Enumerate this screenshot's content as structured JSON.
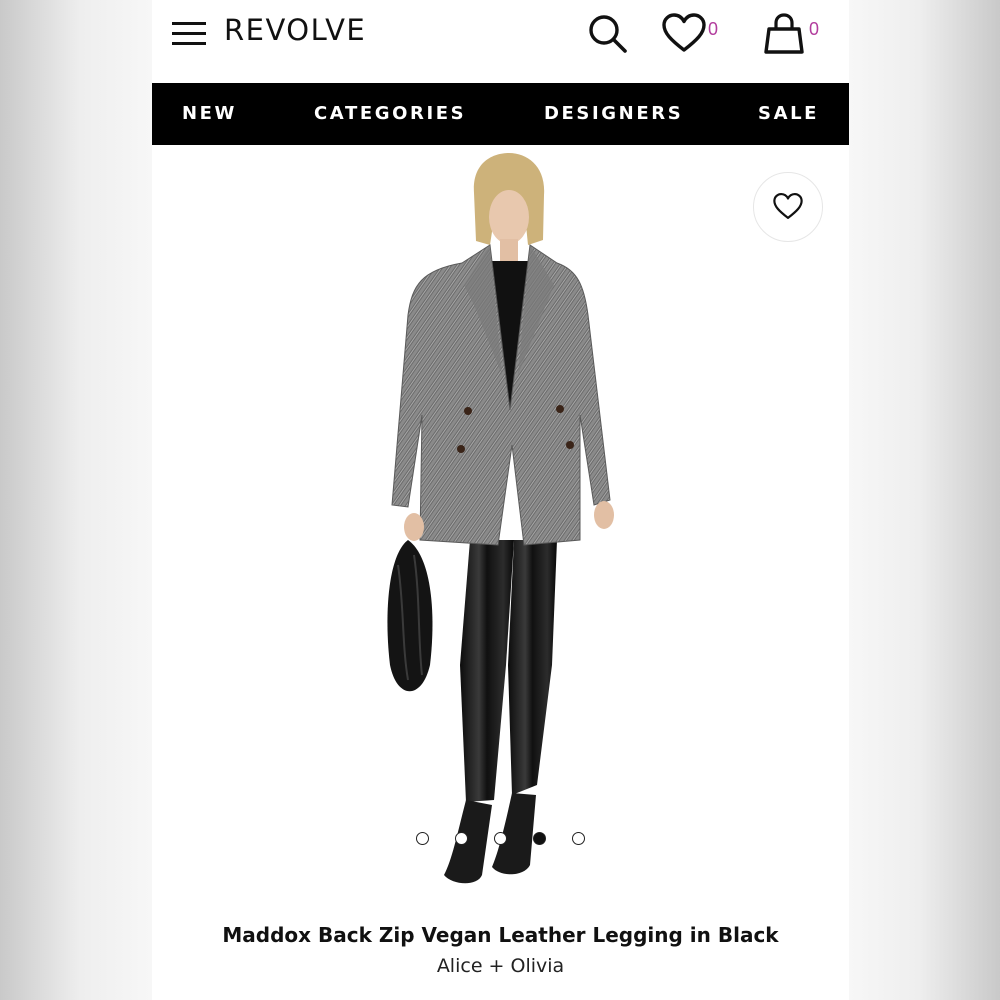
{
  "header": {
    "logo": "REVOLVE",
    "menu_icon": "hamburger-menu-icon",
    "search_icon": "search-icon",
    "wishlist_icon": "heart-icon",
    "wishlist_count": "0",
    "bag_icon": "shopping-bag-icon",
    "bag_count": "0",
    "accent_color": "#b23d9d"
  },
  "nav": {
    "items": [
      {
        "label": "NEW"
      },
      {
        "label": "CATEGORIES"
      },
      {
        "label": "DESIGNERS"
      },
      {
        "label": "SALE"
      }
    ],
    "background": "#000000"
  },
  "product": {
    "favorite_icon": "heart-icon",
    "image_count": 5,
    "active_image": 4,
    "title": "Maddox Back Zip Vegan Leather Legging in Black",
    "brand": "Alice + Olivia"
  }
}
